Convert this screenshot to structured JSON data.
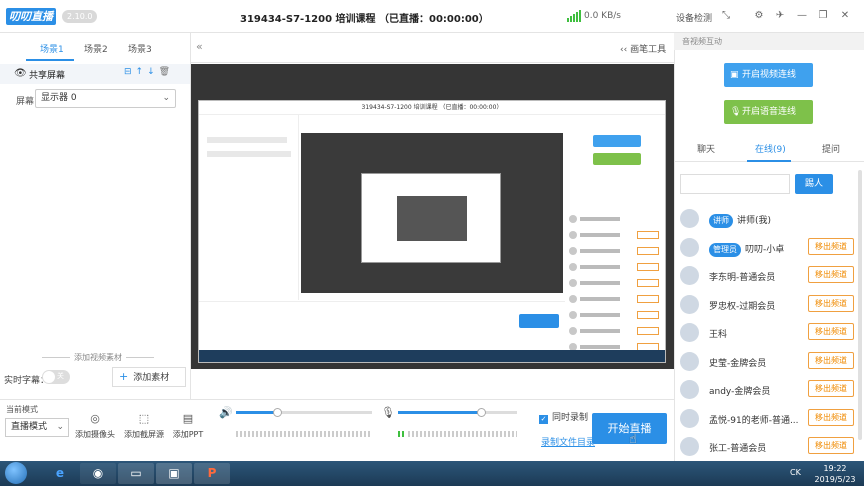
{
  "titlebar": {
    "logo": "叨叨直播",
    "version": "2.10.0",
    "title": "319434-S7-1200 培训课程 （已直播：00:00:00）",
    "net_speed": "0.0 KB/s",
    "device_check": "设备检测",
    "buttons": [
      "collapse-icon",
      "gear-icon",
      "pin-icon",
      "minimize-icon",
      "restore-icon",
      "close-icon"
    ]
  },
  "scenes": {
    "tabs": [
      "场景1",
      "场景2",
      "场景3"
    ],
    "active": 0,
    "share_label": "共享屏幕",
    "screen_label": "屏幕",
    "screen_value": "显示器 0",
    "add_material_title": "添加视频素材",
    "realtime_subtitle_label": "实时字幕：",
    "toggle_text": "关",
    "add_material_button": "添加素材"
  },
  "preview": {
    "draw_tool": "画笔工具",
    "inner_title": "319434-S7-1200 培训课程 （已直播：00:00:00）"
  },
  "bottom": {
    "mode_label": "当前模式",
    "mode_value": "直播模式",
    "tools": [
      "添加摄像头",
      "添加截屏源",
      "添加PPT"
    ],
    "speaker_volume": 0.3,
    "mic_volume": 0.7,
    "sync_record": "同时录制",
    "record_dir": "录制文件目录",
    "start_live": "开始直播"
  },
  "right": {
    "header": "音视频互动",
    "video_btn": "开启视频连线",
    "voice_btn": "开启语音连线",
    "tabs": [
      "聊天",
      "在线(9)",
      "提问"
    ],
    "active_tab": 1,
    "kick_btn": "踢人",
    "users": [
      {
        "role": "讲师",
        "name": "讲师(我)",
        "kick": ""
      },
      {
        "role": "管理员",
        "name": "叨叨-小卓",
        "kick": "移出频道"
      },
      {
        "role": "",
        "name": "李东明-普通会员",
        "kick": "移出频道"
      },
      {
        "role": "",
        "name": "罗忠权-过期会员",
        "kick": "移出频道"
      },
      {
        "role": "",
        "name": "王科",
        "kick": "移出频道"
      },
      {
        "role": "",
        "name": "史莹-金牌会员",
        "kick": "移出频道"
      },
      {
        "role": "",
        "name": "andy-金牌会员",
        "kick": "移出频道"
      },
      {
        "role": "",
        "name": "孟悦-91的老师-普通...",
        "kick": "移出频道"
      },
      {
        "role": "",
        "name": "张工-普通会员",
        "kick": "移出频道"
      }
    ]
  },
  "taskbar": {
    "tray": "CK",
    "time": "19:22",
    "date": "2019/5/23"
  },
  "colors": {
    "accent": "#2b8fe6",
    "video_btn": "#3fa1ee",
    "voice_btn": "#7ec14a",
    "kick": "#f08a00"
  }
}
